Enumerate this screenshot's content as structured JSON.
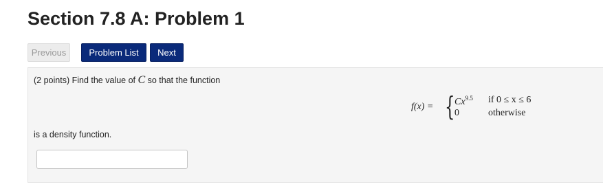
{
  "page": {
    "title": "Section 7.8 A: Problem 1"
  },
  "nav": {
    "previous_label": "Previous",
    "problem_list_label": "Problem List",
    "next_label": "Next"
  },
  "problem": {
    "prompt_pre": "(2 points) Find the value of ",
    "prompt_var": "C",
    "prompt_post": " so that the function",
    "formula": {
      "lhs": "f(x) =",
      "row1_value_base": "Cx",
      "row1_value_exp": "9.5",
      "row1_condition": "if  0 ≤ x ≤ 6",
      "row2_value": "0",
      "row2_condition": "otherwise"
    },
    "post_text": "is a density function.",
    "answer_value": ""
  },
  "colors": {
    "primary_button": "#0a2a7a",
    "disabled_button": "#ececec",
    "panel_background": "#f5f5f5"
  }
}
